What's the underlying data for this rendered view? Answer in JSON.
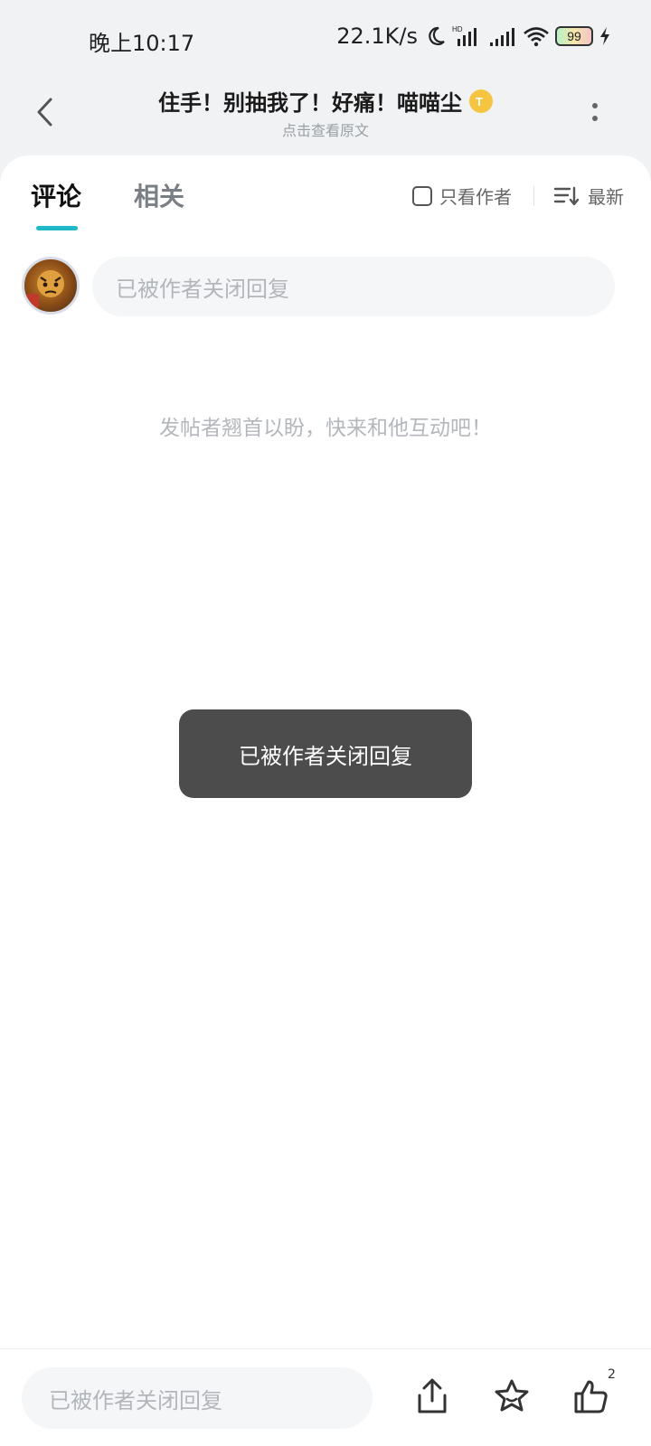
{
  "status_bar": {
    "time": "晚上10:17",
    "net_speed": "22.1K/s",
    "battery": "99",
    "icons": [
      "moon-icon",
      "hd-signal-icon",
      "signal-icon",
      "wifi-icon",
      "battery-icon",
      "charging-icon"
    ]
  },
  "header": {
    "title": "住手！别抽我了！好痛！喵喵尘",
    "badge_icon": "coin-badge-icon",
    "subtitle": "点击查看原文"
  },
  "tabs": {
    "comments": "评论",
    "related": "相关",
    "author_only": "只看作者",
    "sort": "最新"
  },
  "comment_input": {
    "placeholder": "已被作者关闭回复"
  },
  "empty_state": {
    "text": "发帖者翘首以盼，快来和他互动吧！"
  },
  "toast": {
    "text": "已被作者关闭回复"
  },
  "bottom_bar": {
    "placeholder": "已被作者关闭回复",
    "like_count": "2",
    "icons": [
      "share-icon",
      "favorite-icon",
      "like-icon"
    ]
  },
  "colors": {
    "accent": "#1fb8c9",
    "background": "#f1f2f4",
    "toast_bg": "#4c4c4c"
  }
}
